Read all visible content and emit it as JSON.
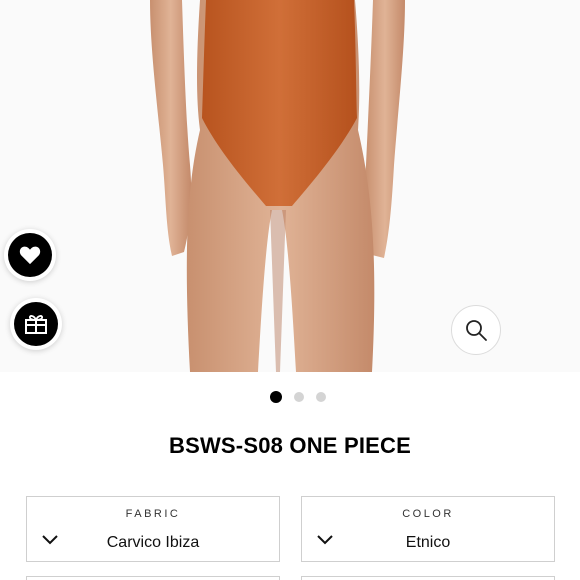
{
  "product": {
    "title": "BSWS-S08 ONE PIECE",
    "image_alt": "Orange one piece swimsuit"
  },
  "actions": {
    "wishlist_icon": "heart-icon",
    "gift_icon": "gift-icon",
    "zoom_icon": "magnifier-icon"
  },
  "carousel": {
    "total": 3,
    "active": 1
  },
  "options": {
    "fabric": {
      "label": "FABRIC",
      "value": "Carvico Ibiza"
    },
    "color": {
      "label": "COLOR",
      "value": "Etnico"
    }
  },
  "colors": {
    "swimsuit": "#c8642e",
    "skin": "#d9a98a",
    "accent": "#000000"
  }
}
